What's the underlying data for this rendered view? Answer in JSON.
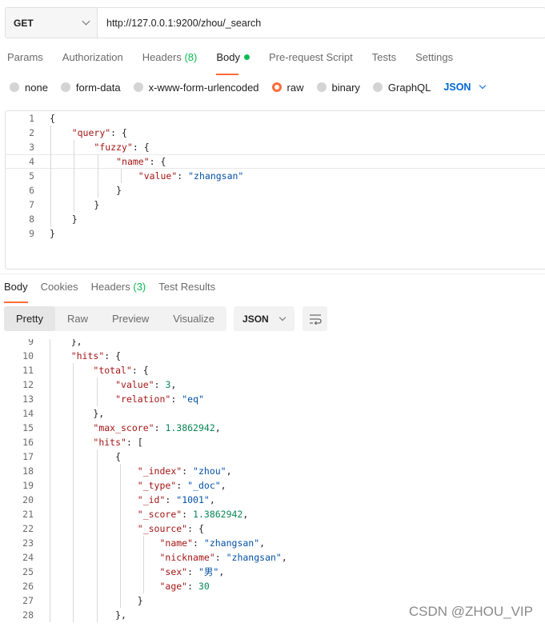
{
  "request": {
    "method": "GET",
    "url": "http://127.0.0.1:9200/zhou/_search"
  },
  "request_tabs": [
    {
      "label": "Params"
    },
    {
      "label": "Authorization"
    },
    {
      "label": "Headers",
      "count": "(8)"
    },
    {
      "label": "Body"
    },
    {
      "label": "Pre-request Script"
    },
    {
      "label": "Tests"
    },
    {
      "label": "Settings"
    }
  ],
  "body_modes": [
    "none",
    "form-data",
    "x-www-form-urlencoded",
    "raw",
    "binary",
    "GraphQL"
  ],
  "body_mode_selected": "raw",
  "body_language": "JSON",
  "request_body": [
    {
      "n": "1",
      "text": "{"
    },
    {
      "n": "2",
      "text": "    \"query\": {"
    },
    {
      "n": "3",
      "text": "        \"fuzzy\": {"
    },
    {
      "n": "4",
      "text": "            \"name\": {"
    },
    {
      "n": "5",
      "text": "                \"value\": \"zhangsan\""
    },
    {
      "n": "6",
      "text": "            }"
    },
    {
      "n": "7",
      "text": "        }"
    },
    {
      "n": "8",
      "text": "    }"
    },
    {
      "n": "9",
      "text": "}"
    }
  ],
  "response_tabs": [
    {
      "label": "Body"
    },
    {
      "label": "Cookies"
    },
    {
      "label": "Headers",
      "count": "(3)"
    },
    {
      "label": "Test Results"
    }
  ],
  "view_modes": [
    "Pretty",
    "Raw",
    "Preview",
    "Visualize"
  ],
  "view_mode_selected": "Pretty",
  "response_format": "JSON",
  "response_body": [
    {
      "n": "9",
      "text": "    },"
    },
    {
      "n": "10",
      "text": "    \"hits\": {"
    },
    {
      "n": "11",
      "text": "        \"total\": {"
    },
    {
      "n": "12",
      "text": "            \"value\": 3,"
    },
    {
      "n": "13",
      "text": "            \"relation\": \"eq\""
    },
    {
      "n": "14",
      "text": "        },"
    },
    {
      "n": "15",
      "text": "        \"max_score\": 1.3862942,"
    },
    {
      "n": "16",
      "text": "        \"hits\": ["
    },
    {
      "n": "17",
      "text": "            {"
    },
    {
      "n": "18",
      "text": "                \"_index\": \"zhou\","
    },
    {
      "n": "19",
      "text": "                \"_type\": \"_doc\","
    },
    {
      "n": "20",
      "text": "                \"_id\": \"1001\","
    },
    {
      "n": "21",
      "text": "                \"_score\": 1.3862942,"
    },
    {
      "n": "22",
      "text": "                \"_source\": {"
    },
    {
      "n": "23",
      "text": "                    \"name\": \"zhangsan\","
    },
    {
      "n": "24",
      "text": "                    \"nickname\": \"zhangsan\","
    },
    {
      "n": "25",
      "text": "                    \"sex\": \"男\","
    },
    {
      "n": "26",
      "text": "                    \"age\": 30"
    },
    {
      "n": "27",
      "text": "                }"
    },
    {
      "n": "28",
      "text": "            },"
    }
  ],
  "watermark": "CSDN @ZHOU_VIP",
  "colors": {
    "accent": "#ff6c37",
    "count_green": "#0cbb52",
    "link_blue": "#0265d2"
  }
}
